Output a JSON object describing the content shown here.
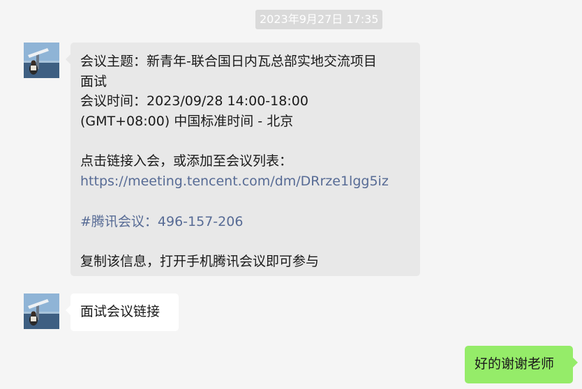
{
  "timestamp": "2023年9月27日 17:35",
  "messages": [
    {
      "sender": "other",
      "lines": [
        "会议主题：新青年-联合国日内瓦总部实地交流项目",
        "面试",
        "会议时间：2023/09/28 14:00-18:00",
        "(GMT+08:00) 中国标准时间 - 北京",
        "",
        "点击链接入会，或添加至会议列表：",
        "https://meeting.tencent.com/dm/DRrze1lgg5iz",
        "",
        "#腾讯会议：496-157-206",
        "",
        "复制该信息，打开手机腾讯会议即可参与"
      ]
    },
    {
      "sender": "other",
      "text": "面试会议链接"
    },
    {
      "sender": "self",
      "text": "好的谢谢老师"
    }
  ],
  "colors": {
    "background": "#f5f5f5",
    "incoming_bubble": "#e8e8e8",
    "incoming_bubble_plain": "#ffffff",
    "outgoing_bubble": "#95ec69",
    "link": "#576b95"
  }
}
